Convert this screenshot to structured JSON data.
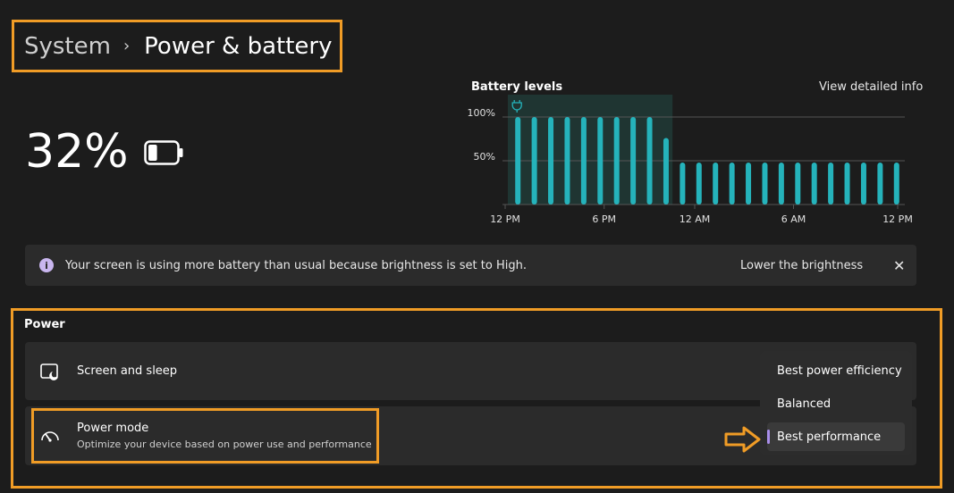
{
  "breadcrumb": {
    "parent": "System",
    "separator": "›",
    "current": "Power & battery"
  },
  "battery": {
    "percent_text": "32%",
    "level_fraction": 0.32
  },
  "chart_data": {
    "type": "bar",
    "title": "Battery levels",
    "link": "View detailed info",
    "xticks": [
      "12 PM",
      "6 PM",
      "12 AM",
      "6 AM",
      "12 PM"
    ],
    "yticks": [
      "100%",
      "50%"
    ],
    "ylim": [
      0,
      100
    ],
    "grid": true,
    "values": [
      100,
      100,
      100,
      100,
      100,
      100,
      100,
      100,
      100,
      76,
      48,
      48,
      48,
      48,
      48,
      48,
      48,
      48,
      48,
      48,
      48,
      48,
      48,
      48
    ],
    "plugged_in_range": [
      0,
      10
    ],
    "bar_color": "#25b3bb",
    "plug_icon": "plug-icon"
  },
  "notice": {
    "icon": "info-icon",
    "text": "Your screen is using more battery than usual because brightness is set to High.",
    "link": "Lower the brightness",
    "close": "✕"
  },
  "power": {
    "heading": "Power",
    "screen_sleep": {
      "icon": "screen-sleep-icon",
      "title": "Screen and sleep"
    },
    "power_mode": {
      "icon": "gauge-icon",
      "title": "Power mode",
      "subtitle": "Optimize your device based on power use and performance",
      "options": [
        "Best power efficiency",
        "Balanced",
        "Best performance"
      ],
      "selected": "Best performance"
    }
  },
  "colors": {
    "highlight": "#f09c26",
    "accent": "#a98eea",
    "bar": "#25b3bb"
  }
}
